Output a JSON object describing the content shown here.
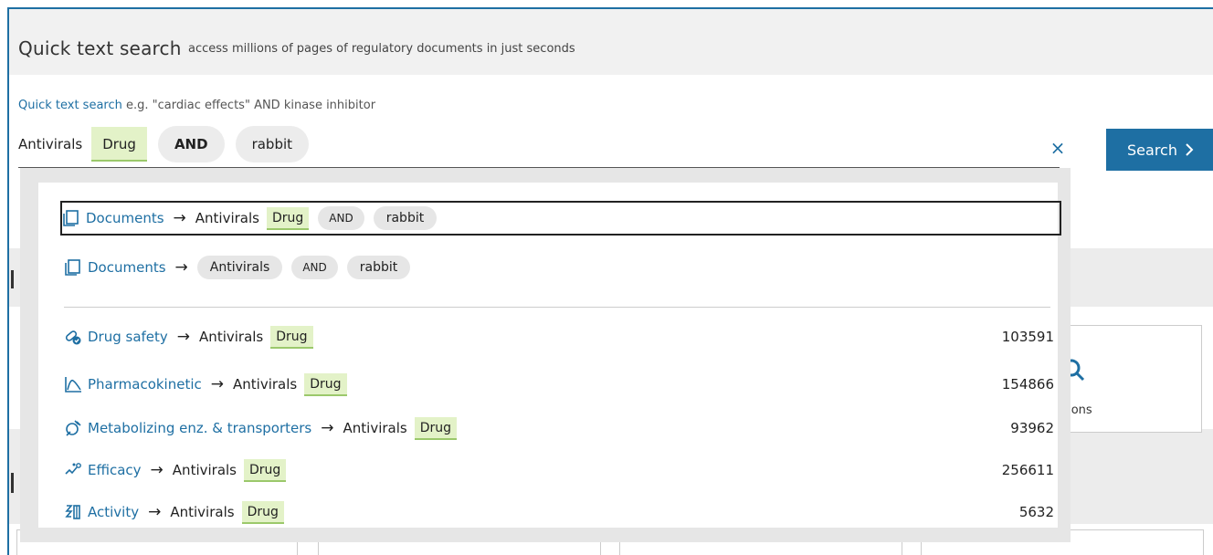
{
  "header": {
    "title": "Quick text search",
    "subtitle": "access millions of pages of regulatory documents in just seconds"
  },
  "hint": {
    "link": "Quick text search",
    "example": "e.g. \"cardiac effects\" AND kinase inhibitor"
  },
  "query": {
    "term1": "Antivirals",
    "tag": "Drug",
    "operator": "AND",
    "term2": "rabbit"
  },
  "search_button": {
    "label": "Search",
    "icon": "chevron-right-icon"
  },
  "clear_button": {
    "icon": "close-icon",
    "glyph": "×"
  },
  "background": {
    "card_label": "tions"
  },
  "dropdown": {
    "arrow": "→",
    "documents_rows": [
      {
        "category": "Documents",
        "icon": "document-icon",
        "term": "Antivirals",
        "tag": "Drug",
        "operator": "AND",
        "term2": "rabbit",
        "selected": true
      },
      {
        "category": "Documents",
        "icon": "document-icon",
        "term": "Antivirals",
        "operator": "AND",
        "term2": "rabbit",
        "selected": false
      }
    ],
    "category_rows": [
      {
        "category": "Drug safety",
        "icon": "drug-safety-icon",
        "term": "Antivirals",
        "tag": "Drug",
        "count": "103591"
      },
      {
        "category": "Pharmacokinetic",
        "icon": "pharmacokinetic-icon",
        "term": "Antivirals",
        "tag": "Drug",
        "count": "154866"
      },
      {
        "category": "Metabolizing enz. & transporters",
        "icon": "metabolizing-icon",
        "term": "Antivirals",
        "tag": "Drug",
        "count": "93962"
      },
      {
        "category": "Efficacy",
        "icon": "efficacy-icon",
        "term": "Antivirals",
        "tag": "Drug",
        "count": "256611"
      },
      {
        "category": "Activity",
        "icon": "activity-icon",
        "term": "Antivirals",
        "tag": "Drug",
        "count": "5632"
      }
    ]
  },
  "colors": {
    "accent": "#1e6fa3",
    "tag_bg": "#e3f2c8",
    "tag_border": "#9bc86b",
    "pill_bg": "#ececec"
  }
}
